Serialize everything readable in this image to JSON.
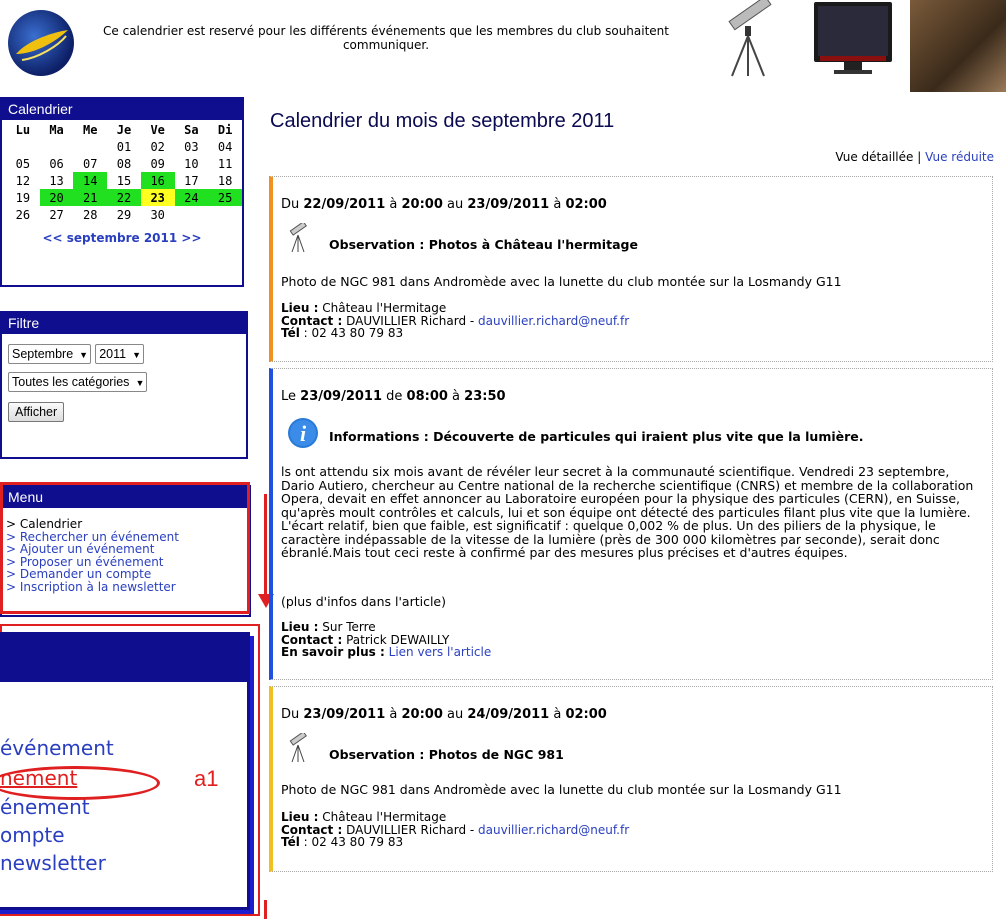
{
  "header": {
    "intro": "Ce calendrier est reservé pour les différents événements que les membres du club souhaitent communiquer."
  },
  "calendar": {
    "title": "Calendrier",
    "weekdays": [
      "Lu",
      "Ma",
      "Me",
      "Je",
      "Ve",
      "Sa",
      "Di"
    ],
    "weeks": [
      [
        "",
        "",
        "",
        "01",
        "02",
        "03",
        "04"
      ],
      [
        "05",
        "06",
        "07",
        "08",
        "09",
        "10",
        "11"
      ],
      [
        "12",
        "13",
        "14",
        "15",
        "16",
        "17",
        "18"
      ],
      [
        "19",
        "20",
        "21",
        "22",
        "23",
        "24",
        "25"
      ],
      [
        "26",
        "27",
        "28",
        "29",
        "30",
        "",
        ""
      ]
    ],
    "event_days": [
      "14",
      "16",
      "20",
      "21",
      "22",
      "24",
      "25"
    ],
    "today": "23",
    "prev": "<<",
    "month_label": "septembre 2011",
    "next": ">>",
    "event_color": "#20e020",
    "today_color": "#ffff20"
  },
  "filter": {
    "title": "Filtre",
    "month_value": "Septembre",
    "year_value": "2011",
    "category_value": "Toutes les catégories",
    "submit_label": "Afficher"
  },
  "menu": {
    "title": "Menu",
    "items": [
      "> Calendrier",
      "> Rechercher un événement",
      "> Ajouter un événement",
      "> Proposer un événement",
      "> Demander un compte",
      "> Inscription à la newsletter"
    ]
  },
  "zoom": {
    "lines": [
      "événement",
      "nement",
      "énement",
      "ompte",
      "newsletter"
    ],
    "annotation": "a1"
  },
  "main": {
    "page_title": "Calendrier du mois de septembre 2011",
    "view_detailed": "Vue détaillée",
    "separator": "|",
    "view_reduced": "Vue réduite"
  },
  "events": [
    {
      "when": [
        "Du ",
        "22/09/2011",
        " à ",
        "20:00",
        " au ",
        "23/09/2011",
        " à ",
        "02:00"
      ],
      "icon": "telescope-icon",
      "title": "Observation : Photos à Château l'hermitage",
      "description": "Photo de NGC 981 dans Andromède avec la lunette du club montée sur la Losmandy G11",
      "lieu_label": "Lieu :",
      "lieu": " Château l'Hermitage",
      "contact_label": "Contact :",
      "contact": " DAUVILLIER Richard - ",
      "email": "dauvillier.richard@neuf.fr",
      "tel_label": "Tél",
      "tel": " : 02 43 80 79 83"
    },
    {
      "when": [
        "Le ",
        "23/09/2011",
        " de ",
        "08:00",
        " à ",
        "23:50",
        "",
        ""
      ],
      "icon": "info-icon",
      "title": "Informations : Découverte de particules qui iraient plus vite que la lumière.",
      "description": "ls ont attendu six mois avant de révéler leur secret à la communauté scientifique. Vendredi 23 septembre, Dario Autiero, chercheur au Centre national de la recherche scientifique (CNRS) et membre de la collaboration Opera, devait en effet annoncer au Laboratoire européen pour la physique des particules (CERN), en Suisse, qu'après moult contrôles et calculs, lui et son équipe ont détecté des particules filant plus vite que la lumière. L'écart relatif, bien que faible, est significatif : quelque 0,002 % de plus. Un des piliers de la physique, le caractère indépassable de la vitesse de la lumière (près de 300 000 kilomètres par seconde), serait donc ébranlé.Mais tout ceci reste à confirmé par des mesures plus précises et d'autres équipes.",
      "more": "(plus d'infos dans l'article)",
      "lieu_label": "Lieu :",
      "lieu": " Sur Terre",
      "contact_label": "Contact :",
      "contact": " Patrick DEWAILLY",
      "savoir_label": "En savoir plus :",
      "savoir_link": "Lien vers l'article"
    },
    {
      "when": [
        "Du ",
        "23/09/2011",
        " à ",
        "20:00",
        " au ",
        "24/09/2011",
        " à ",
        "02:00"
      ],
      "icon": "telescope-icon",
      "title": "Observation : Photos de NGC 981",
      "description": "Photo de NGC 981 dans Andromède avec la lunette du club montée sur la Losmandy G11",
      "lieu_label": "Lieu :",
      "lieu": " Château l'Hermitage",
      "contact_label": "Contact :",
      "contact": " DAUVILLIER Richard - ",
      "email": "dauvillier.richard@neuf.fr",
      "tel_label": "Tél",
      "tel": " : 02 43 80 79 83"
    }
  ],
  "colors": {
    "panel_blue": "#0e0e8e",
    "link": "#2a3fbf",
    "annotation_red": "#e02020"
  }
}
